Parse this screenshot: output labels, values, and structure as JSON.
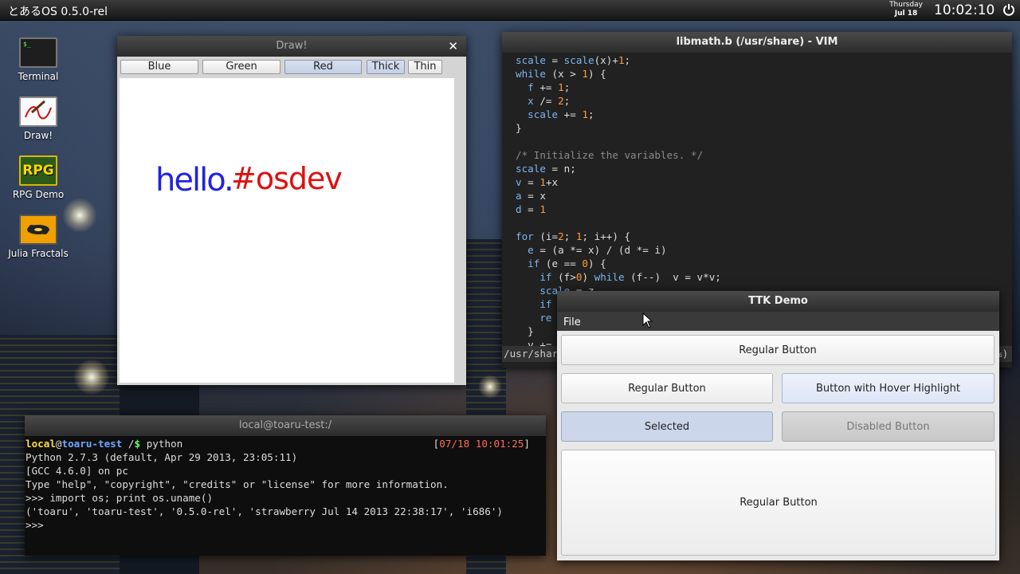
{
  "panel": {
    "title": "とあるOS 0.5.0-rel",
    "date_day": "Thursday",
    "date_date": "Jul 18",
    "clock": "10:02:10",
    "power_icon": "power-icon"
  },
  "desktop_icons": [
    {
      "label": "Terminal",
      "icon": "terminal-icon"
    },
    {
      "label": "Draw!",
      "icon": "draw-icon"
    },
    {
      "label": "RPG Demo",
      "icon": "rpg-icon",
      "icon_text": "RPG"
    },
    {
      "label": "Julia Fractals",
      "icon": "julia-icon"
    }
  ],
  "draw_window": {
    "title": "Draw!",
    "buttons": [
      "Blue",
      "Green",
      "Red",
      "Thick",
      "Thin"
    ],
    "text_blue": "hello.",
    "text_red": "#osdev",
    "colors": {
      "blue": "#2222dd",
      "red": "#dd1111"
    }
  },
  "vim_window": {
    "title": "libmath.b (/usr/share) - VIM",
    "status": "/usr/shar",
    "status_right": "%)"
  },
  "terminal_window": {
    "title": "local@toaru-test:/",
    "prompt_user": "local",
    "prompt_at": "@",
    "prompt_host": "toaru-test",
    "prompt_path": " /",
    "prompt_symbol": "$",
    "prompt_command": " python",
    "stamp_open": "[",
    "stamp": "07/18 10:01:25",
    "stamp_close": "]",
    "lines": [
      "Python 2.7.3 (default, Apr 29 2013, 23:05:11)",
      "[GCC 4.6.0] on pc",
      "Type \"help\", \"copyright\", \"credits\" or \"license\" for more information.",
      ">>> import os; print os.uname()",
      "('toaru', 'toaru-test', '0.5.0-rel', 'strawberry Jul 14 2013 22:38:17', 'i686')",
      ">>>"
    ]
  },
  "ttk_window": {
    "title": "TTK Demo",
    "menu_file": "File",
    "btn_regular_1": "Regular Button",
    "btn_regular_2": "Regular Button",
    "btn_hover": "Button with Hover Highlight",
    "btn_selected": "Selected",
    "btn_disabled": "Disabled Button",
    "btn_regular_3": "Regular Button"
  },
  "colors": {
    "keyword": "#7bb5ee",
    "number": "#ff9b3a",
    "comment": "#8a8a8a",
    "prompt_user": "#ffd94a",
    "prompt_host": "#6ca8ff",
    "stamp": "#ff6d5a"
  }
}
